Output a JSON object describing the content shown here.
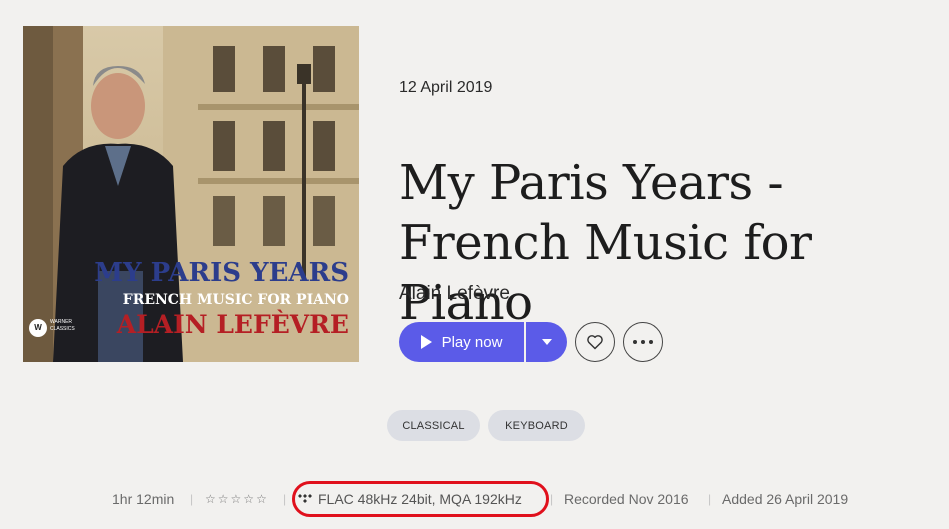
{
  "album": {
    "release_date": "12 April 2019",
    "title": "My Paris Years - French Music for Piano",
    "artist": "Alain Lefèvre"
  },
  "cover": {
    "line1": "My Paris Years",
    "line2": "French Music for Piano",
    "line3": "Alain Lefèvre",
    "label_logo": "W",
    "label_text": "WARNER CLASSICS"
  },
  "actions": {
    "play_label": "Play now",
    "play_icon": "play-icon",
    "dropdown_icon": "chevron-down-icon",
    "favorite_icon": "heart-icon",
    "more_icon": "more-icon"
  },
  "tags": [
    "CLASSICAL",
    "KEYBOARD"
  ],
  "meta": {
    "duration": "1hr 12min",
    "rating": 0,
    "rating_max": 5,
    "format": "FLAC 48kHz 24bit, MQA 192kHz",
    "format_icon": "tidal-icon",
    "recorded": "Recorded Nov 2016",
    "added": "Added 26 April 2019"
  },
  "colors": {
    "accent": "#5b5be8",
    "background": "#f2f1ef",
    "highlight": "#e0101c",
    "tag_bg": "#dcdee4"
  }
}
